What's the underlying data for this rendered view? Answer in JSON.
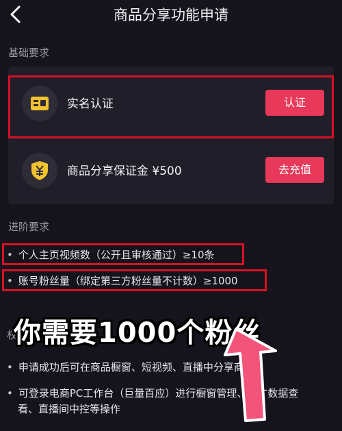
{
  "header": {
    "title": "商品分享功能申请",
    "back_icon": "chevron-left-icon"
  },
  "basic": {
    "label": "基础要求",
    "items": [
      {
        "label": "实名认证",
        "button": "认证",
        "icon": "id-card-icon"
      },
      {
        "label": "商品分享保证金 ¥500",
        "button": "去充值",
        "icon": "yuan-shield-icon"
      }
    ]
  },
  "advanced": {
    "label": "进阶要求",
    "items": [
      "个人主页视频数（公开且审核通过）≥10条",
      "账号粉丝量（绑定第三方粉丝量不计数）≥1000"
    ]
  },
  "overlay": {
    "text": "你需要1000个粉丝"
  },
  "benefits": {
    "label_partial": "权",
    "items": [
      "申请成功后可在商品橱窗、短视频、直播中分享商品",
      "可登录电商PC工作台（巨量百应）进行橱窗管理、推广数据查",
      "看、直播间中控等操作"
    ]
  },
  "colors": {
    "accent": "#e8395a",
    "highlight_box": "#d91125",
    "background": "#15141c",
    "card": "#201f29"
  }
}
